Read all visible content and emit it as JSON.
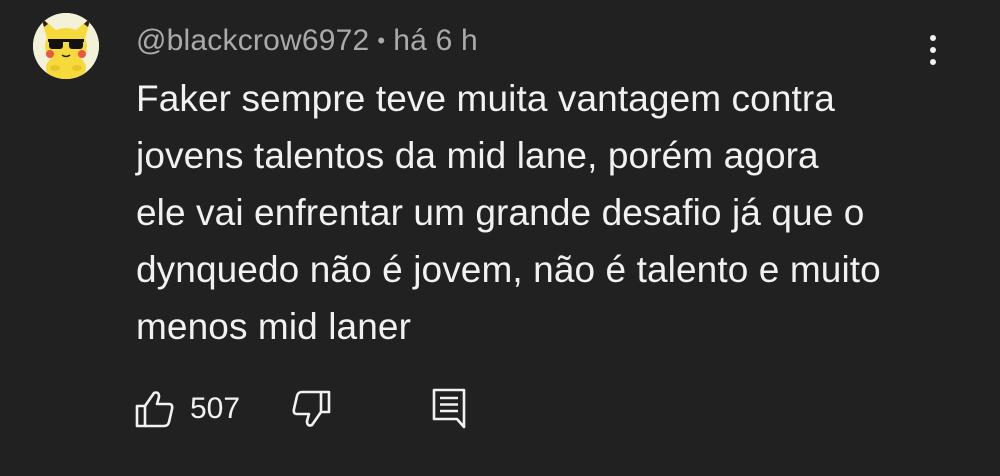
{
  "comment": {
    "author": "@blackcrow6972",
    "separator": "•",
    "timestamp": "há 6 h",
    "lines": [
      "Faker sempre teve muita vantagem contra",
      "jovens talentos da mid lane, porém agora",
      "ele vai enfrentar um grande desafio já que o",
      "dynquedo não é jovem, não é talento e muito",
      "menos mid laner"
    ],
    "like_count": "507"
  },
  "icons": {
    "avatar": "pikachu-with-sunglasses",
    "menu": "more-vertical-icon",
    "like": "thumbs-up-icon",
    "dislike": "thumbs-down-icon",
    "reply": "comment-reply-icon"
  },
  "colors": {
    "background": "#212121",
    "text_primary": "#f1f1f1",
    "text_secondary": "#aaaaaa"
  }
}
